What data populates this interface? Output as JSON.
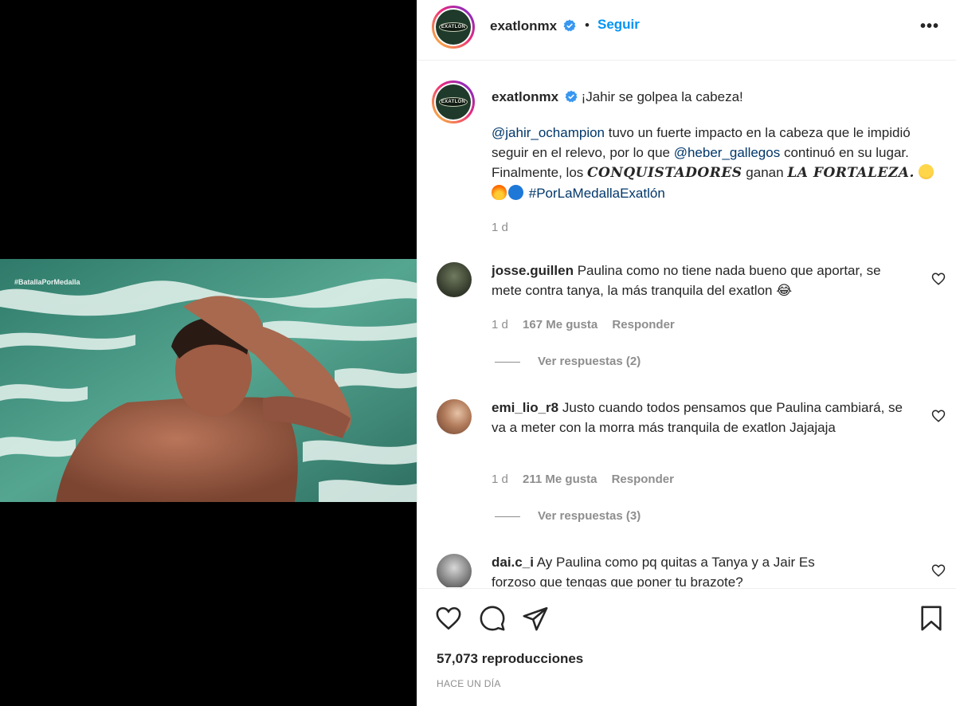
{
  "video": {
    "tag": "#BatallaPorMedalla"
  },
  "header": {
    "avatar_logo": "EXATLÓN",
    "username": "exatlonmx",
    "separator": "•",
    "follow_label": "Seguir",
    "more_label": "•••"
  },
  "caption": {
    "username": "exatlonmx",
    "title": "¡Jahir se golpea la cabeza!",
    "mention1": "@jahir_ochampion",
    "text1": " tuvo un fuerte impacto en la cabeza que le impidió seguir en el relevo, por lo que ",
    "mention2": "@heber_gallegos",
    "text2": " continuó en su lugar. Finalmente, los ",
    "bold1": "CONQUISTADORES",
    "text3": " ganan ",
    "bold2": "LA FORTALEZA.",
    "hashtag": "#PorLaMedallaExatlón",
    "time": "1 d"
  },
  "comments": [
    {
      "username": "josse.guillen",
      "text": "Paulina como no tiene nada bueno que aportar, se mete contra tanya, la más tranquila del exatlon 😂",
      "time": "1 d",
      "likes": "167 Me gusta",
      "reply": "Responder",
      "view_replies": "Ver respuestas (2)"
    },
    {
      "username": "emi_lio_r8",
      "text": "Justo cuando todos pensamos que Paulina cambiará, se va a meter con la morra más tranquila de exatlon Jajajaja",
      "time": "1 d",
      "likes": "211 Me gusta",
      "reply": "Responder",
      "view_replies": "Ver respuestas (3)"
    },
    {
      "username": "dai.c_i",
      "text": "Ay Paulina como pq quitas a Tanya y a Jair Es forzoso que tengas que poner tu brazote?"
    }
  ],
  "footer": {
    "views": "57,073 reproducciones",
    "when": "HACE UN DÍA"
  },
  "colors": {
    "link": "#0095f6",
    "mention": "#00376b",
    "muted": "#8e8e8e",
    "text": "#262626"
  }
}
